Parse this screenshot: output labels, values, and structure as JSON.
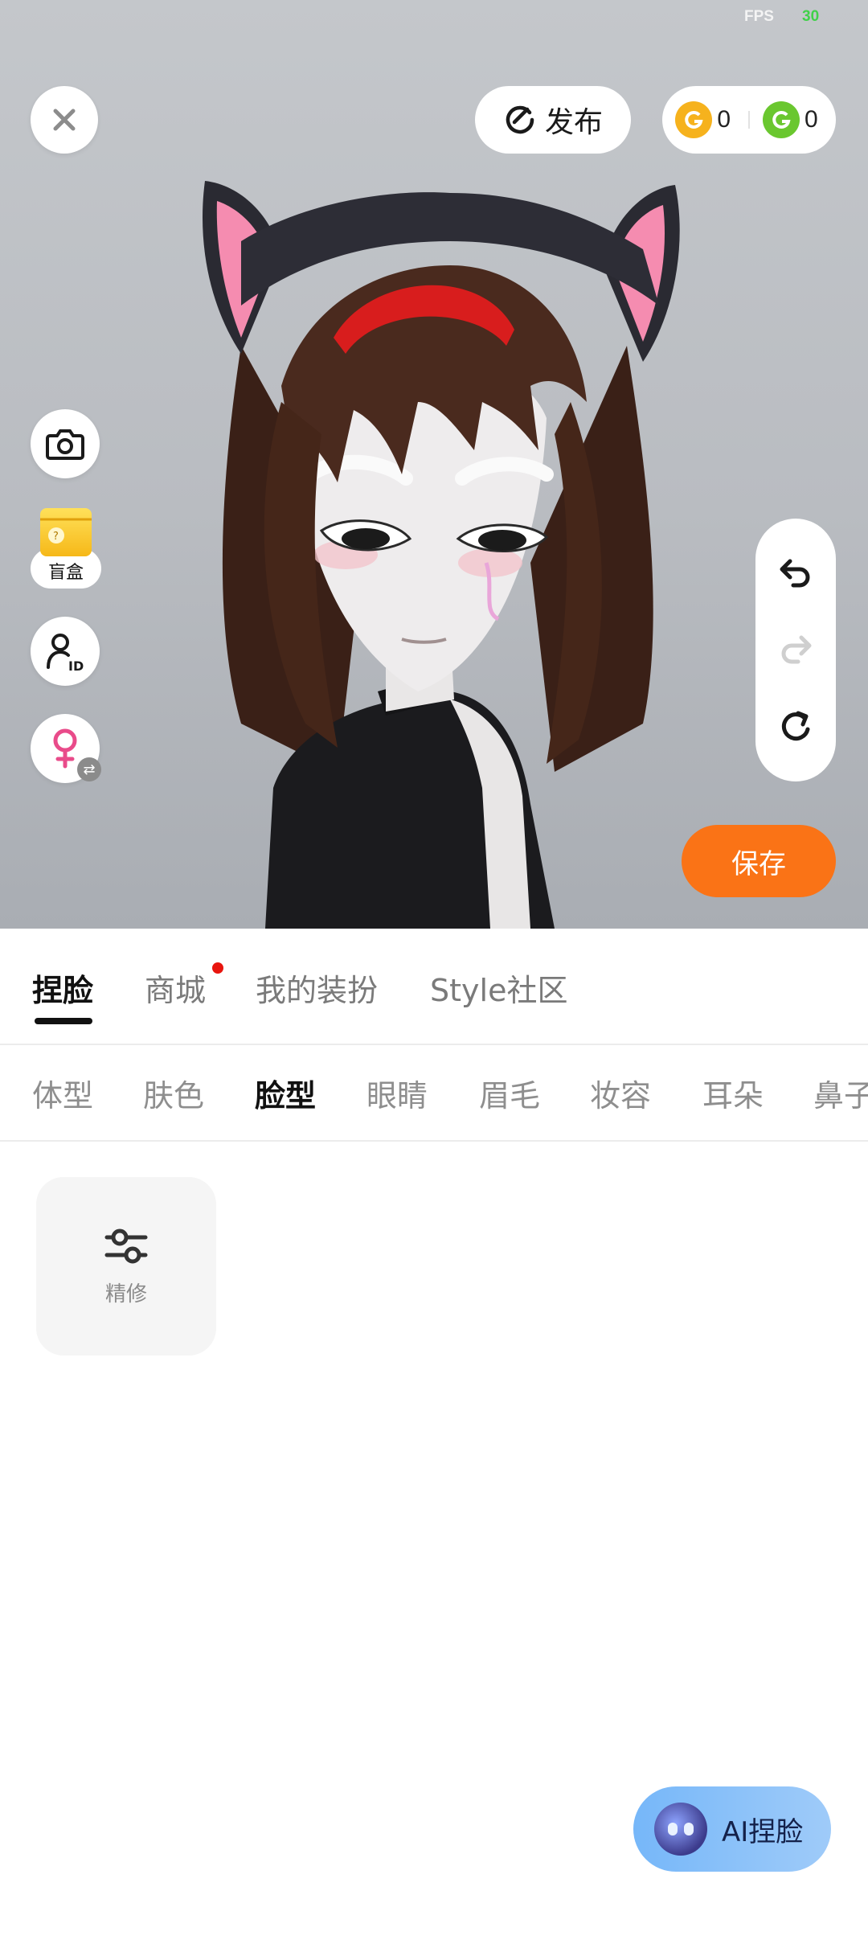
{
  "status": {
    "fps_label": "FPS",
    "fps_value": "30"
  },
  "top_bar": {
    "publish_label": "发布",
    "coin_gold": "0",
    "coin_green": "0"
  },
  "left_tools": {
    "blind_box_label": "盲盒"
  },
  "save_label": "保存",
  "main_tabs": [
    {
      "label": "捏脸",
      "active": true
    },
    {
      "label": "商城",
      "badge": true
    },
    {
      "label": "我的装扮"
    },
    {
      "label": "Style社区"
    }
  ],
  "sub_tabs": [
    {
      "label": "体型"
    },
    {
      "label": "肤色"
    },
    {
      "label": "脸型",
      "active": true
    },
    {
      "label": "眼睛"
    },
    {
      "label": "眉毛"
    },
    {
      "label": "妆容"
    },
    {
      "label": "耳朵"
    },
    {
      "label": "鼻子"
    }
  ],
  "tools": [
    {
      "label": "精修"
    }
  ],
  "ai_button_label": "AI捏脸",
  "colors": {
    "accent_orange": "#fa7316",
    "badge_red": "#e8150e",
    "fps_green": "#41d14a"
  }
}
